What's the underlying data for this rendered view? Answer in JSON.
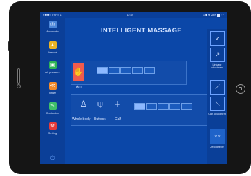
{
  "status_bar": {
    "carrier": "●●●●○ FSRS ⟟",
    "time": "12:34",
    "battery": "⟟ ◉ ⊕ 28% ▆ ▫ +"
  },
  "title": "INTELLIGENT MASSAGE",
  "left_nav": [
    {
      "icon": "automatic-icon",
      "glyph": "◎",
      "label": "Automatic"
    },
    {
      "icon": "manual-icon",
      "glyph": "▲",
      "label": "Manual"
    },
    {
      "icon": "air-pressure-icon",
      "glyph": "▣",
      "label": "Air pressure"
    },
    {
      "icon": "other-icon",
      "glyph": "≪",
      "label": "Other"
    },
    {
      "icon": "customize-icon",
      "glyph": "✎",
      "label": "Customize"
    },
    {
      "icon": "setting-icon",
      "glyph": "⚙",
      "label": "Setting"
    }
  ],
  "power_glyph": "⏻",
  "arm": {
    "label": "Arm",
    "level": 1,
    "max": 5,
    "glyph": "✋"
  },
  "body": {
    "labels": [
      "Whole body",
      "Buttock",
      "Calf"
    ],
    "level": 1,
    "max": 5
  },
  "right_nav": [
    {
      "icon": "chair-recline-icon",
      "glyph": "↙",
      "label": ""
    },
    {
      "icon": "chair-upright-icon",
      "glyph": "↗",
      "label": "Linkage adjustment"
    },
    {
      "icon": "calf-up-icon",
      "glyph": "⟋",
      "label": ""
    },
    {
      "icon": "calf-down-icon",
      "glyph": "⟍",
      "label": "Calf adjustment"
    },
    {
      "icon": "zero-gravity-icon",
      "glyph": "〰",
      "label": "Zero gravity"
    }
  ]
}
